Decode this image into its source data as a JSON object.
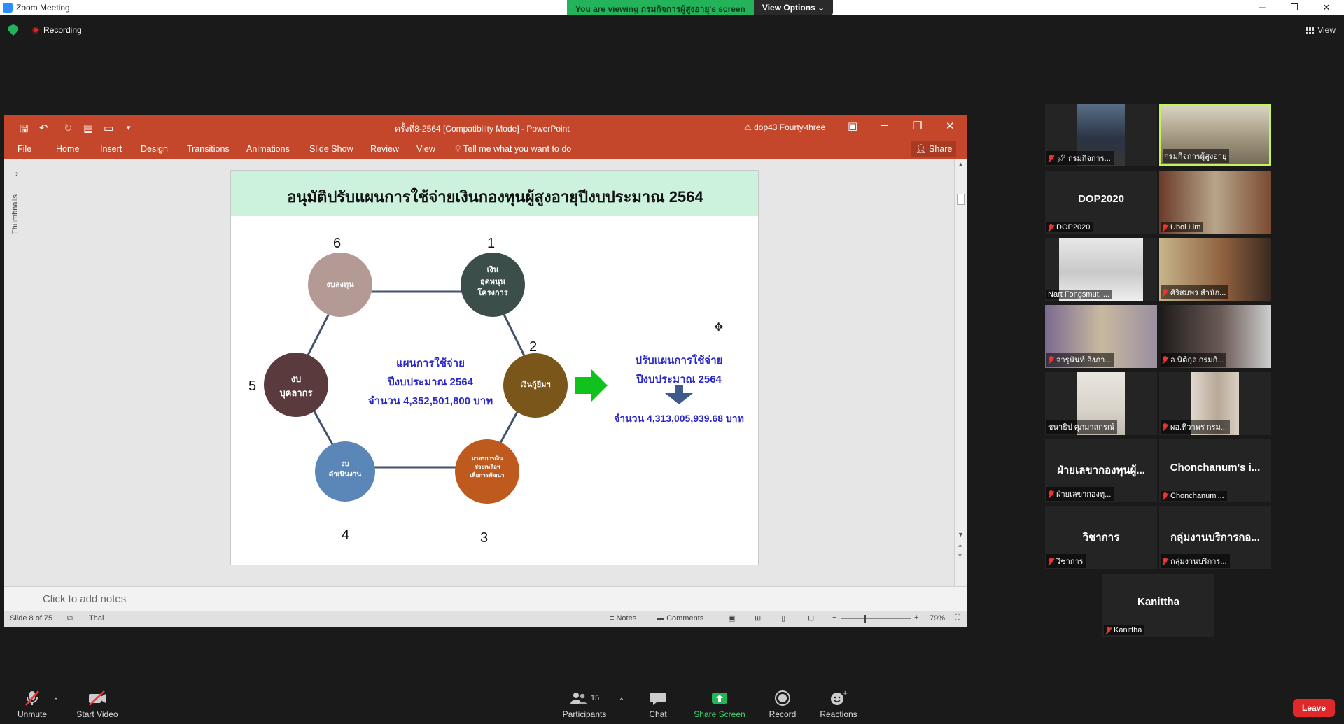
{
  "window": {
    "title": "Zoom Meeting",
    "minimize": "─",
    "maximize": "❐",
    "close": "✕"
  },
  "banner": {
    "message": "You are viewing กรมกิจการผู้สูงอายุ's screen",
    "view_options": "View Options ⌄"
  },
  "recording": "Recording",
  "view_button": "View",
  "ppt": {
    "doc_title": "ครั้งที่8-2564 [Compatibility Mode]  -  PowerPoint",
    "user": "dop43 Fourty-three",
    "tabs": [
      "File",
      "Home",
      "Insert",
      "Design",
      "Transitions",
      "Animations",
      "Slide Show",
      "Review",
      "View"
    ],
    "tell_me": "Tell me what you want to do",
    "share": "Share",
    "thumbnails": "Thumbnails",
    "notes_placeholder": "Click to add notes",
    "status": {
      "slide": "Slide 8 of 75",
      "language": "Thai",
      "notes": "Notes",
      "comments": "Comments",
      "zoom": "79%"
    }
  },
  "slide": {
    "title": "อนุมัติปรับแผนการใช้จ่ายเงินกองทุนผู้สูงอายุปีงบประมาณ 2564",
    "center_text": [
      "แผนการใช้จ่าย",
      "ปีงบประมาณ 2564",
      "จำนวน 4,352,501,800 บาท"
    ],
    "right_text": [
      "ปรับแผนการใช้จ่าย",
      "ปีงบประมาณ 2564"
    ],
    "right_amount": "จำนวน 4,313,005,939.68 บาท",
    "nodes": [
      {
        "num": "1",
        "label": [
          "เงิน",
          "อุดหนุน",
          "โครงการ"
        ],
        "color": "#3b4e49"
      },
      {
        "num": "2",
        "label": [
          "เงินกู้ยืมฯ"
        ],
        "color": "#7a561b"
      },
      {
        "num": "3",
        "label": [
          "มาตรการเงิน",
          "ช่วยเหลือฯ",
          "เพื่อการพัฒนา"
        ],
        "color": "#bf5a1e"
      },
      {
        "num": "4",
        "label": [
          "งบ",
          "ดำเนินงาน"
        ],
        "color": "#5b87b8"
      },
      {
        "num": "5",
        "label": [
          "งบ",
          "บุคลากร"
        ],
        "color": "#5a3a3c"
      },
      {
        "num": "6",
        "label": [
          "งบลงทุน"
        ],
        "color": "#b49a95"
      }
    ]
  },
  "gallery": [
    {
      "name": "กรมกิจการ...",
      "big": ""
    },
    {
      "name": "กรมกิจการผู้สูงอายุ",
      "big": ""
    },
    {
      "name": "DOP2020",
      "big": "DOP2020"
    },
    {
      "name": "Ubol Lim",
      "big": ""
    },
    {
      "name": "Nart Fongsmut, ...",
      "big": ""
    },
    {
      "name": "ศิริสมพร สำนัก...",
      "big": ""
    },
    {
      "name": "จารุนันท์ อิ่งภา...",
      "big": ""
    },
    {
      "name": "อ.นิติกุล กรมกิ...",
      "big": ""
    },
    {
      "name": "ชนาธิป ศุภมาสกรณ์",
      "big": ""
    },
    {
      "name": "ผอ.ทิวาพร กรม...",
      "big": ""
    },
    {
      "name": "ฝ่ายเลขากองทุ...",
      "big": "ฝ่ายเลขากองทุนผู้..."
    },
    {
      "name": "Chonchanum'...",
      "big": "Chonchanum's i..."
    },
    {
      "name": "วิชาการ",
      "big": "วิชาการ"
    },
    {
      "name": "กลุ่มงานบริการ...",
      "big": "กลุ่มงานบริการกอ..."
    },
    {
      "name": "Kanittha",
      "big": "Kanittha"
    }
  ],
  "toolbar": {
    "unmute": "Unmute",
    "start_video": "Start Video",
    "participants": "Participants",
    "participants_count": "15",
    "chat": "Chat",
    "share_screen": "Share Screen",
    "record": "Record",
    "reactions": "Reactions",
    "leave": "Leave"
  },
  "colors": {
    "zoom_green": "#23b35a",
    "ppt_red": "#c5472b",
    "leave_red": "#e0282a",
    "slide_blue_text": "#2a28c8",
    "slide_header_mint": "#ccf2de"
  }
}
